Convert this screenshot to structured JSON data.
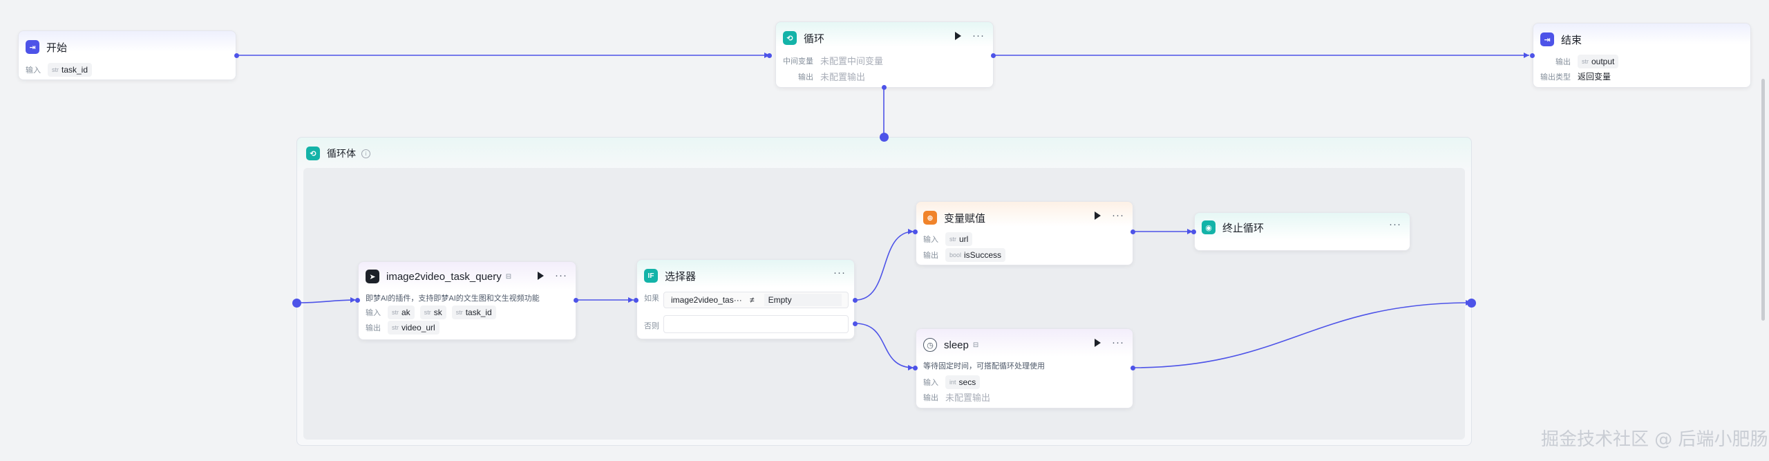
{
  "start": {
    "title": "开始",
    "input_label": "输入",
    "inputs": [
      {
        "type": "str",
        "name": "task_id"
      }
    ]
  },
  "loop": {
    "title": "循环",
    "var_label": "中间变量",
    "var_value": "未配置中间变量",
    "output_label": "输出",
    "output_value": "未配置输出"
  },
  "end": {
    "title": "结束",
    "output_label": "输出",
    "outputs": [
      {
        "type": "str",
        "name": "output"
      }
    ],
    "type_label": "输出类型",
    "type_value": "返回变量"
  },
  "loop_body": {
    "title": "循环体"
  },
  "plugin": {
    "title": "image2video_task_query",
    "desc": "即梦AI的插件，支持即梦AI的文生图和文生视频功能",
    "input_label": "输入",
    "inputs": [
      {
        "type": "str",
        "name": "ak"
      },
      {
        "type": "str",
        "name": "sk"
      },
      {
        "type": "str",
        "name": "task_id"
      }
    ],
    "output_label": "输出",
    "outputs": [
      {
        "type": "str",
        "name": "video_url"
      }
    ]
  },
  "selector": {
    "title": "选择器",
    "if_label": "如果",
    "left_operand": "image2video_tas···",
    "operator": "≠",
    "right_operand": "Empty",
    "else_label": "否则"
  },
  "assign": {
    "title": "变量赋值",
    "input_label": "输入",
    "inputs": [
      {
        "type": "str",
        "name": "url"
      }
    ],
    "output_label": "输出",
    "outputs": [
      {
        "type": "bool",
        "name": "isSuccess"
      }
    ]
  },
  "terminate": {
    "title": "终止循环"
  },
  "sleep": {
    "title": "sleep",
    "desc": "等待固定时间，可搭配循环处理使用",
    "input_label": "输入",
    "inputs": [
      {
        "type": "int",
        "name": "secs"
      }
    ],
    "output_label": "输出",
    "output_value": "未配置输出"
  },
  "watermark": "掘金技术社区 @ 后端小肥肠",
  "colors": {
    "edge": "#4d53e8",
    "start_icon": "#4d53e8",
    "loop_icon": "#13b3a8",
    "assign_icon": "#f0832a",
    "terminate_icon": "#13b3a8",
    "selector_icon": "#13b3a8"
  }
}
